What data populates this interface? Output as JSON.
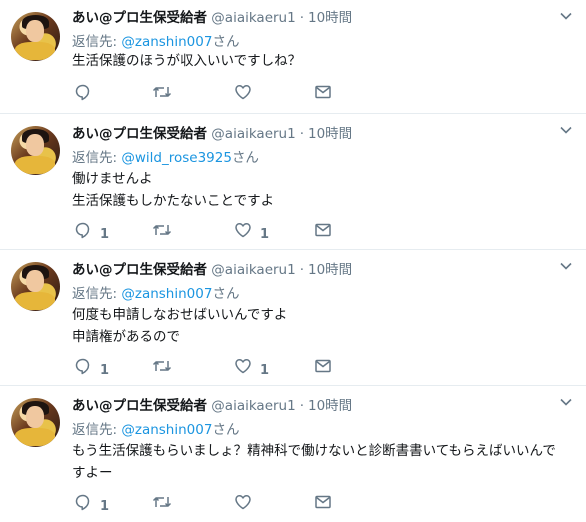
{
  "tweets": [
    {
      "name": "あい@プロ生保受給者",
      "handle": "@aiaikaeru1",
      "separator": "·",
      "time": "10時間",
      "reply_prefix": "返信先:",
      "reply_mention": "@zanshin007",
      "reply_suffix": "さん",
      "lines": [
        "生活保護のほうが収入いいですしね？"
      ],
      "reply_count": "",
      "retweet_count": "",
      "like_count": ""
    },
    {
      "name": "あい@プロ生保受給者",
      "handle": "@aiaikaeru1",
      "separator": "·",
      "time": "10時間",
      "reply_prefix": "返信先:",
      "reply_mention": "@wild_rose3925",
      "reply_suffix": "さん",
      "lines": [
        "働けませんよ",
        "生活保護もしかたないことですよ"
      ],
      "reply_count": "1",
      "retweet_count": "",
      "like_count": "1"
    },
    {
      "name": "あい@プロ生保受給者",
      "handle": "@aiaikaeru1",
      "separator": "·",
      "time": "10時間",
      "reply_prefix": "返信先:",
      "reply_mention": "@zanshin007",
      "reply_suffix": "さん",
      "lines": [
        "何度も申請しなおせばいいんですよ",
        "申請権があるので"
      ],
      "reply_count": "1",
      "retweet_count": "",
      "like_count": "1"
    },
    {
      "name": "あい@プロ生保受給者",
      "handle": "@aiaikaeru1",
      "separator": "·",
      "time": "10時間",
      "reply_prefix": "返信先:",
      "reply_mention": "@zanshin007",
      "reply_suffix": "さん",
      "lines": [
        "もう生活保護もらいましょ？精神科で働けないと診断書書いてもらえばいいんで",
        "すよー"
      ],
      "reply_count": "1",
      "retweet_count": "",
      "like_count": ""
    }
  ],
  "icons": {
    "reply": "reply-icon",
    "retweet": "retweet-icon",
    "like": "heart-icon",
    "dm": "envelope-icon",
    "caret": "chevron-down-icon"
  },
  "colors": {
    "name": "#14171a",
    "secondary": "#657786",
    "mention": "#1b95e0",
    "divider": "#e6ecf0"
  }
}
